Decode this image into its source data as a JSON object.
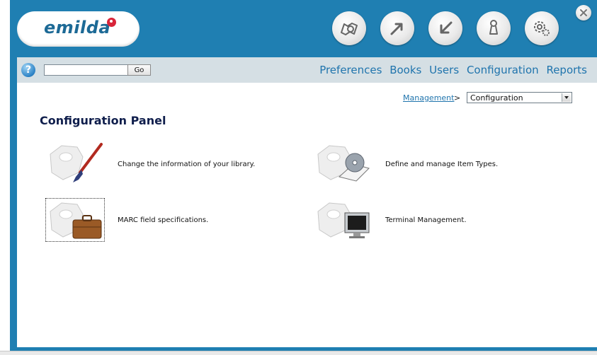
{
  "header": {
    "logo_text": "emilda",
    "buttons": [
      "browse-icon",
      "share-icon",
      "return-icon",
      "pawn-icon",
      "gears-icon"
    ],
    "close_icon": "close-icon"
  },
  "navbar": {
    "search_placeholder": "",
    "search_value": "",
    "go_label": "Go",
    "links": [
      "Preferences",
      "Books",
      "Users",
      "Configuration",
      "Reports"
    ]
  },
  "breadcrumb": {
    "link": "Management",
    "separator": ">",
    "selected": "Configuration"
  },
  "page_title": "Configuration Panel",
  "items": [
    {
      "icon": "library-paintbrush-icon",
      "label": "Change the information of your library."
    },
    {
      "icon": "item-types-book-cd-icon",
      "label": "Define and manage Item Types."
    },
    {
      "icon": "marc-briefcase-icon",
      "label": "MARC field specifications."
    },
    {
      "icon": "terminal-monitor-icon",
      "label": "Terminal Management."
    }
  ],
  "colors": {
    "header_blue": "#1f7fb2",
    "navbar_bg": "#d5dfe4",
    "link_blue": "#1f74ad",
    "title_navy": "#0f1e4c"
  }
}
